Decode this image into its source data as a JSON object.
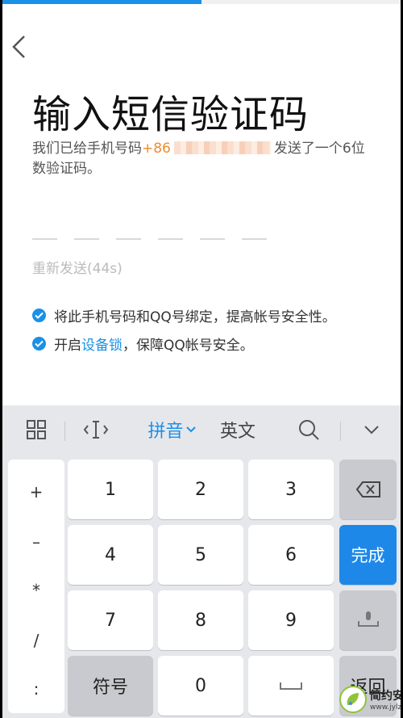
{
  "progress": {
    "fraction": 0.5
  },
  "header": {
    "title": "输入短信验证码"
  },
  "description": {
    "prefix": "我们已给手机号码",
    "country_code": "+86",
    "suffix": "发送了一个6位数验证码。"
  },
  "code_input": {
    "slots": 6
  },
  "resend": {
    "label": "重新发送(44s)"
  },
  "tips": [
    {
      "text": "将此手机号码和QQ号绑定，提高帐号安全性。"
    },
    {
      "before": "开启",
      "link": "设备锁",
      "after": "，保障QQ帐号安全。"
    }
  ],
  "keyboard": {
    "toolbar": {
      "pinyin": "拼音",
      "english": "英文"
    },
    "side_keys": [
      "+",
      "–",
      "*",
      "/",
      ":"
    ],
    "digits": [
      "1",
      "2",
      "3",
      "4",
      "5",
      "6",
      "7",
      "8",
      "9",
      "0"
    ],
    "symbol_label": "符号",
    "done_label": "完成",
    "return_label": "返回"
  },
  "watermark": {
    "name": "简约安卓网",
    "url": "www.jylzwj.com"
  },
  "colors": {
    "accent": "#1a90e6",
    "orange": "#f08c2a",
    "done": "#1e88e9"
  }
}
